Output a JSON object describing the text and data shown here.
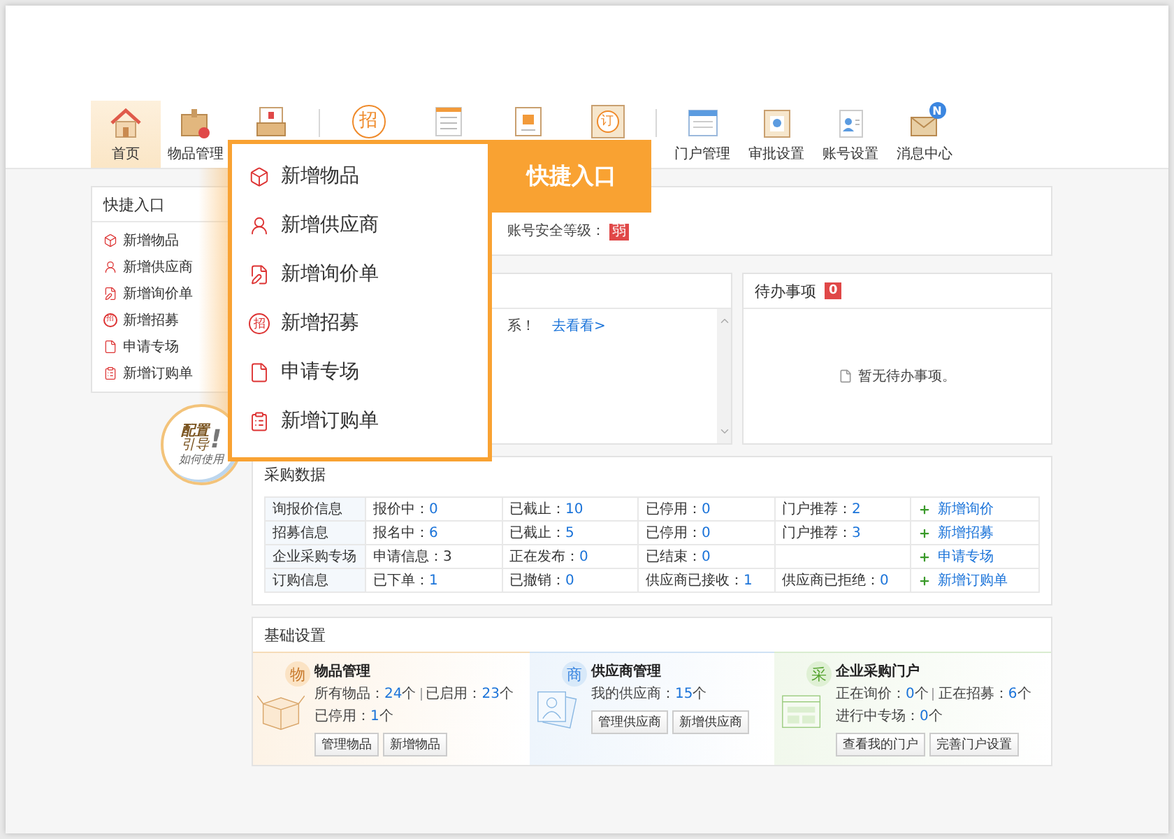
{
  "toolbar": {
    "items": [
      {
        "kind": "home",
        "label": "首页",
        "selected": true
      },
      {
        "kind": "goods",
        "label": "物品管理",
        "selected": false
      },
      {
        "kind": "inbox",
        "selected": false
      },
      {
        "kind": "recruit",
        "glyph": "招",
        "divider_before": true,
        "selected": false
      },
      {
        "kind": "document",
        "selected": false
      },
      {
        "kind": "card",
        "selected": false
      },
      {
        "kind": "order",
        "glyph": "订",
        "selected": false
      },
      {
        "kind": "portal",
        "label": "门户管理",
        "divider_before": true,
        "selected": false
      },
      {
        "kind": "approval",
        "label": "审批设置",
        "selected": false
      },
      {
        "kind": "account",
        "label": "账号设置",
        "selected": false
      },
      {
        "kind": "message",
        "label": "消息中心",
        "badge": "N",
        "selected": false
      }
    ]
  },
  "quick_entry": {
    "title": "快捷入口",
    "items": [
      {
        "kind": "goods",
        "label": "新增物品"
      },
      {
        "kind": "supplier",
        "label": "新增供应商"
      },
      {
        "kind": "inquiry",
        "label": "新增询价单"
      },
      {
        "kind": "recruit",
        "glyph": "招",
        "label": "新增招募"
      },
      {
        "kind": "apply",
        "label": "申请专场"
      },
      {
        "kind": "order",
        "label": "新增订购单"
      }
    ]
  },
  "popup": {
    "tab": "快捷入口",
    "items": [
      {
        "kind": "goods",
        "label": "新增物品"
      },
      {
        "kind": "supplier",
        "label": "新增供应商"
      },
      {
        "kind": "inquiry",
        "label": "新增询价单"
      },
      {
        "kind": "recruit",
        "glyph": "招",
        "label": "新增招募"
      },
      {
        "kind": "apply",
        "label": "申请专场"
      },
      {
        "kind": "order",
        "label": "新增订购单"
      }
    ]
  },
  "guide_badge": {
    "title": "配置",
    "subtitle": "引导",
    "mark": "!",
    "caption": "如何使用"
  },
  "account_panel": {
    "security_label": "账号安全等级：",
    "security_level": "弱"
  },
  "notice_panel": {
    "text": "系！",
    "link": "去看看>"
  },
  "todo_panel": {
    "title": "待办事项",
    "count": "0",
    "empty_text": "暂无待办事项。"
  },
  "purchase_data": {
    "title": "采购数据",
    "rows": [
      {
        "label": "询报价信息",
        "cells": [
          {
            "label": "报价中：",
            "value": "0"
          },
          {
            "label": "已截止：",
            "value": "10"
          },
          {
            "label": "已停用：",
            "value": "0"
          },
          {
            "label": "门户推荐：",
            "value": "2"
          }
        ],
        "action": "新增询价"
      },
      {
        "label": "招募信息",
        "cells": [
          {
            "label": "报名中：",
            "value": "6"
          },
          {
            "label": "已截止：",
            "value": "5"
          },
          {
            "label": "已停用：",
            "value": "0"
          },
          {
            "label": "门户推荐：",
            "value": "3"
          }
        ],
        "action": "新增招募"
      },
      {
        "label": "企业采购专场",
        "cells": [
          {
            "label": "申请信息：3"
          },
          {
            "label": "正在发布：",
            "value": "0"
          },
          {
            "label": "已结束：",
            "value": "0"
          }
        ],
        "action": "申请专场"
      },
      {
        "label": "订购信息",
        "cells": [
          {
            "label": "已下单：",
            "value": "1"
          },
          {
            "label": "已撤销：",
            "value": "0"
          },
          {
            "label": "供应商已接收：",
            "value": "1"
          },
          {
            "label": "供应商已拒绝：",
            "value": "0"
          }
        ],
        "action": "新增订购单"
      }
    ]
  },
  "basic_settings": {
    "title": "基础设置",
    "cards": [
      {
        "kind": "goods",
        "badge": "物",
        "title": "物品管理",
        "lines": [
          [
            {
              "label": "所有物品：",
              "value": "24",
              "unit": "个"
            },
            {
              "label": "已启用：",
              "value": "23",
              "unit": "个"
            }
          ],
          [
            {
              "label": "已停用：",
              "value": "1",
              "unit": "个"
            }
          ]
        ],
        "buttons": [
          "管理物品",
          "新增物品"
        ]
      },
      {
        "kind": "supplier",
        "badge": "商",
        "title": "供应商管理",
        "lines": [
          [
            {
              "label": "我的供应商：",
              "value": "15",
              "unit": "个"
            }
          ]
        ],
        "buttons": [
          "管理供应商",
          "新增供应商"
        ]
      },
      {
        "kind": "portal",
        "badge": "采",
        "title": "企业采购门户",
        "lines": [
          [
            {
              "label": "正在询价：",
              "value": "0",
              "unit": "个"
            },
            {
              "label": "正在招募：",
              "value": "6",
              "unit": "个"
            }
          ],
          [
            {
              "label": "进行中专场：",
              "value": "0",
              "unit": "个"
            }
          ]
        ],
        "buttons": [
          "查看我的门户",
          "完善门户设置"
        ]
      }
    ]
  }
}
